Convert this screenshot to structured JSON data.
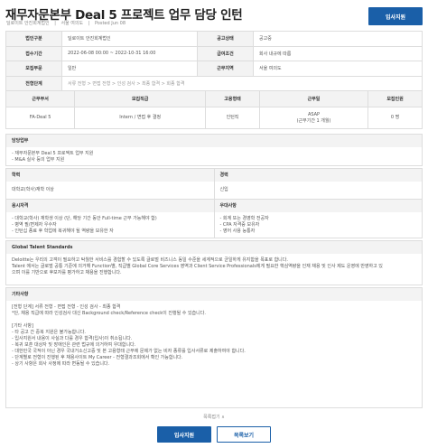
{
  "header": {
    "title": "재무자문본부 Deal 5 프로젝트 업무 담당 인턴",
    "company": "딜로이트 안진회계법인",
    "location": "서울 여의도",
    "posted": "Posted Jun 08",
    "apply_label": "입사지원"
  },
  "info": {
    "rows": [
      {
        "k1": "법인구분",
        "v1": "딜로이트 안진회계법인",
        "k2": "공고상태",
        "v2": "공고중"
      },
      {
        "k1": "접수기간",
        "v1": "2022-06-08 00:00 ~ 2022-10-31 16:00",
        "k2": "급여조건",
        "v2": "회사 내규에 따름"
      },
      {
        "k1": "모집부문",
        "v1": "일반",
        "k2": "근무지역",
        "v2": "서울 여의도"
      }
    ],
    "process_label": "전형단계",
    "process_value": "서류 전형 > 면접 전형 > 인성 검사 > 최종 합격 > 회종 합격"
  },
  "job_table": {
    "headers": [
      "근무부서",
      "모집직급",
      "고용형태",
      "근무일",
      "모집인원"
    ],
    "row": {
      "dept": "FA-Deal 5",
      "grade": "Intern / 면접 후 결정",
      "type": "인턴직",
      "start_line1": "ASAP",
      "start_line2": "(근무기간 1 개월)",
      "count": "0 명"
    }
  },
  "duties": {
    "title": "담당업무",
    "lines": [
      "- 재무자문본부 Deal 5 프로젝트 업무 지원",
      "- M&A 실사 등의 업무 지원"
    ]
  },
  "quals": {
    "edu_title": "학력",
    "edu_value": "대학교(학사)재학 이상",
    "career_title": "경력",
    "career_value": "신입",
    "req_title": "응시자격",
    "req_lines": [
      "- 대학교(학사) 재학생 이상 (단, 해당 기간 동안 Full-time 근무 가능해야 함)",
      "- 병역 필/면제자 우수자",
      "- 인턴십 종료 후 학업에 복귀해야 될 역량을 보유한 자"
    ],
    "pref_title": "우대사항",
    "pref_lines": [
      "- 회계 또는 경영학 전공자",
      "- CPA 자격증 보유자",
      "- 영어 사용 능통자"
    ]
  },
  "gts": {
    "title": "Global Talent Standards",
    "lines": [
      "Deloitte는 우리의 고객이 필요하고 탁월한 서비스를 경험할 수 있도록 글로벌 비즈니스 동일 수준을 세계적으로 균일하게 유지함을 목표로 합니다.",
      "Talent 에서는 글로벌 공통 기준에 의거해 Function별, 직급별 Global Core Services 영역과 Client Service Professionals에게 필요한 핵심역량을 인재 채용 및 인사 제도 운영에 반영하고 있",
      "으며 이를 기반으로 후보자를 평가하고 채용을 진행합니다."
    ]
  },
  "etc": {
    "title": "기타사항",
    "lines": [
      "[전형 단계] 서류 전형 - 면접 전형 - 인성 검사 - 최종 합격",
      "*단, 채용 직급에 따라 인성검사 대신 Background check/Reference check이 진행될 수 있습니다.",
      "",
      "[기타 사항]",
      "- 타 공고 간 중복 지원은 불가능합니다.",
      "- 입사지원서 내용이 사실과 다를 경우 합격(입사)이 취소됩니다.",
      "- 복귀 보훈 대상자 및 장애인은 관련 법규에 의거하여 우대합니다.",
      "- 대한민국 국적이 아닌 경우 국내거소신고증 및 본 고용형태 근무에 문제가 없는 비자 종류를 입사서류로 제출하여야 합니다.",
      "- 단계별로 전형이 진행된 후 채용사이트 My Career - 전형결과조회에서 확인 가능합니다.",
      "- 상기 사항은 회사 사정에 따라 변동될 수 있습니다."
    ]
  },
  "footer": {
    "fold_label": "목록접기 ∧",
    "apply_label": "입사지원",
    "list_label": "목록보기"
  }
}
